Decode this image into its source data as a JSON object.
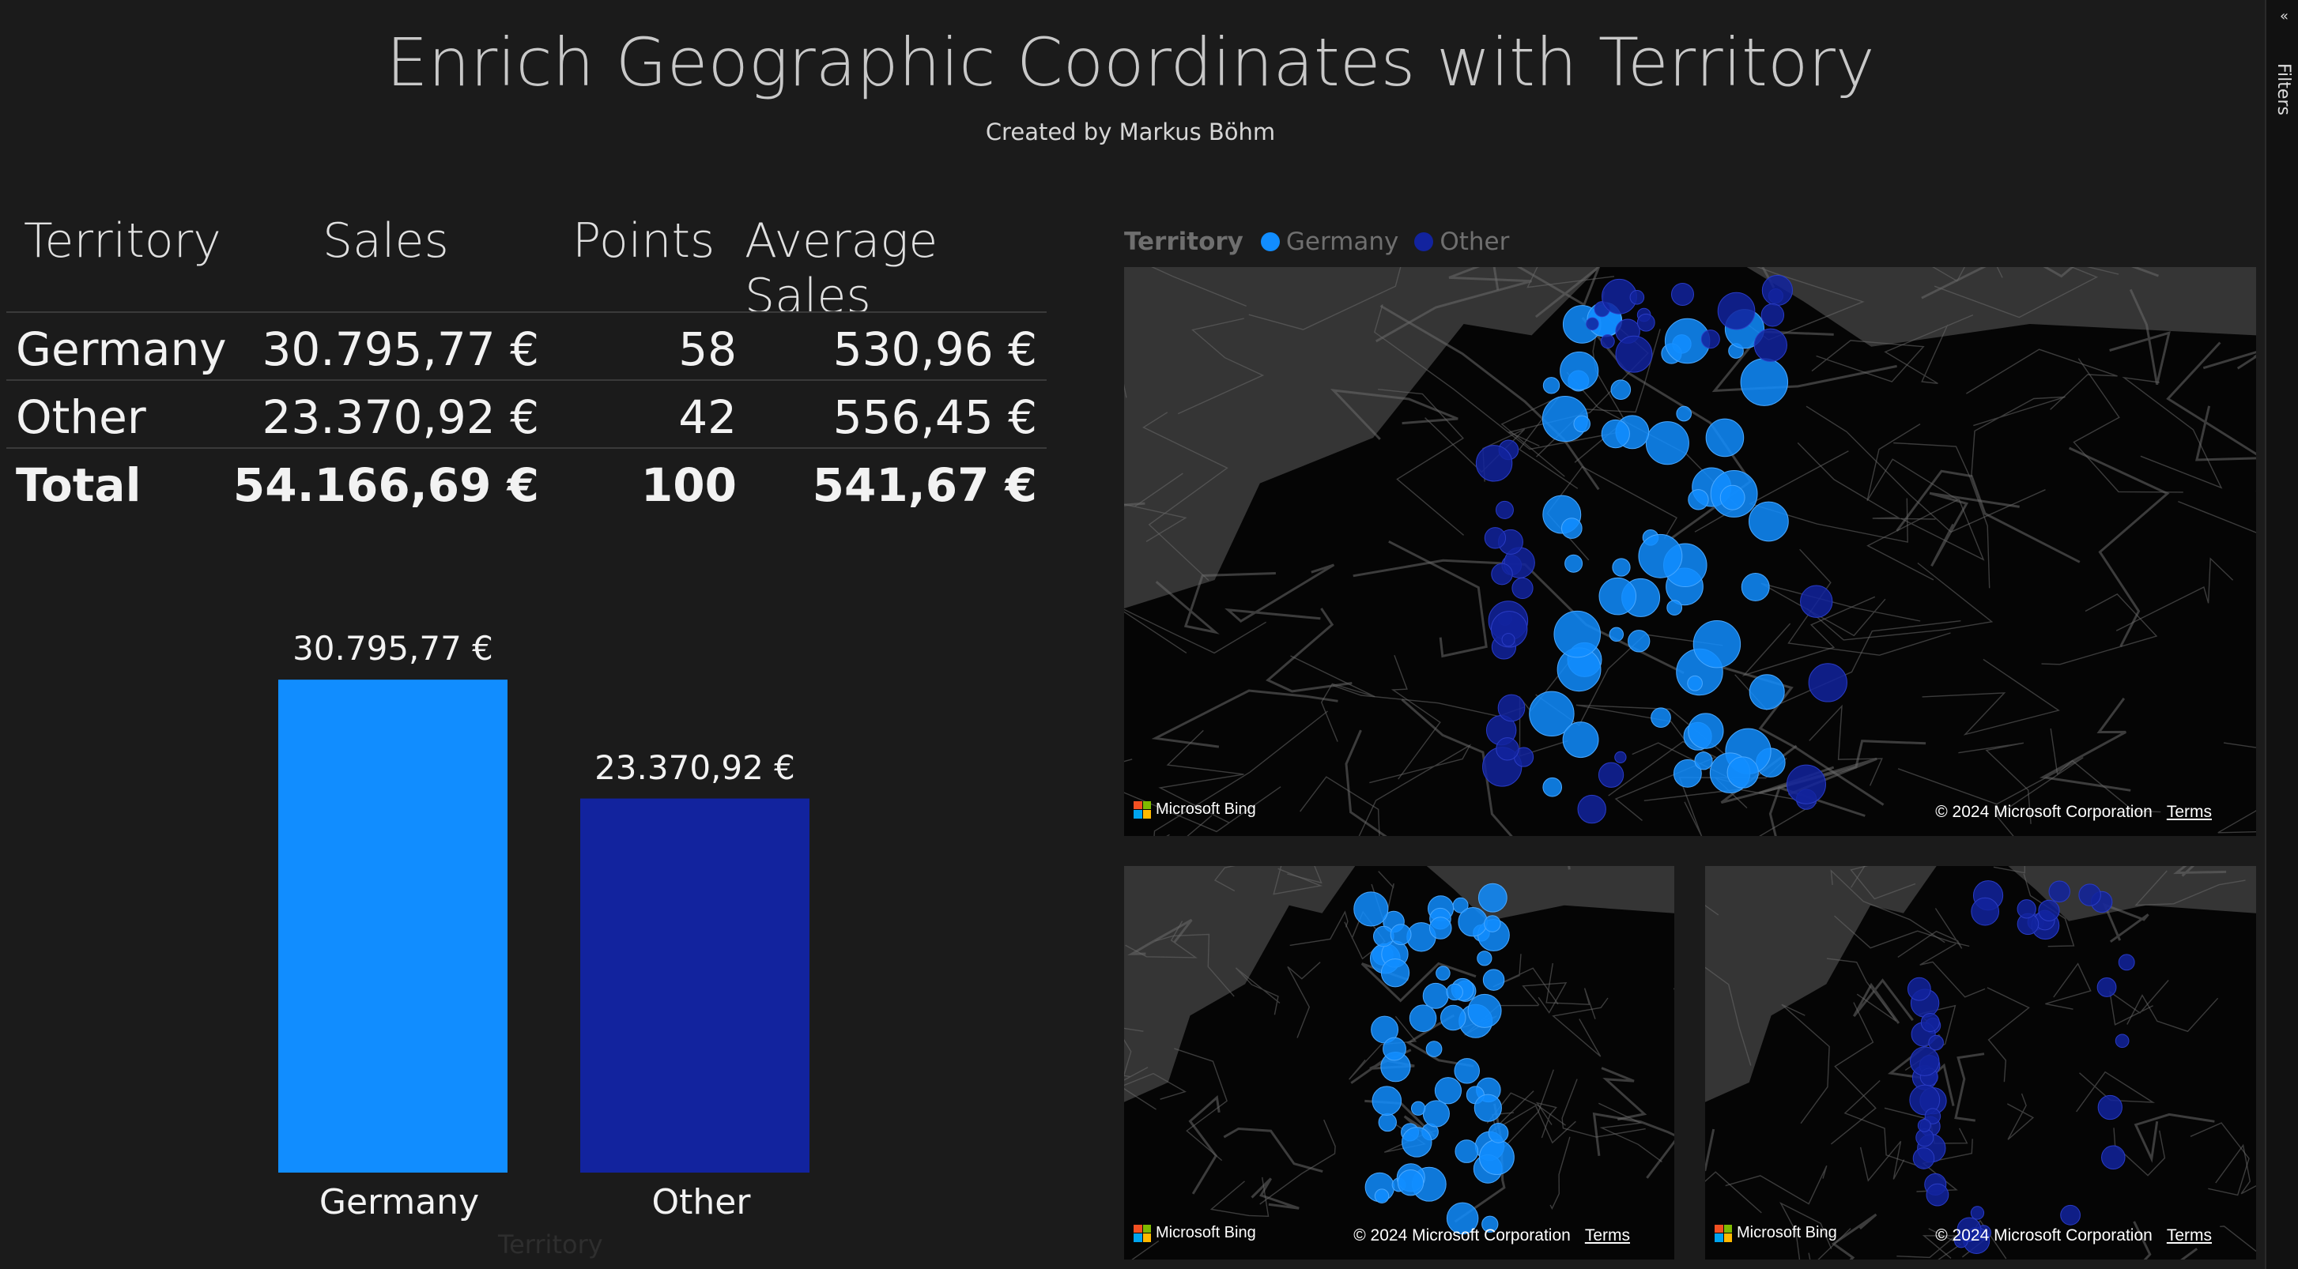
{
  "header": {
    "title": "Enrich Geographic Coordinates with Territory",
    "subtitle": "Created by Markus Böhm"
  },
  "table": {
    "headers": [
      "Territory",
      "Sales",
      "Points",
      "Average Sales"
    ],
    "rows": [
      {
        "territory": "Germany",
        "sales": "30.795,77 €",
        "points": "58",
        "avg": "530,96 €"
      },
      {
        "territory": "Other",
        "sales": "23.370,92 €",
        "points": "42",
        "avg": "556,45 €"
      }
    ],
    "total": {
      "territory": "Total",
      "sales": "54.166,69 €",
      "points": "100",
      "avg": "541,67 €"
    }
  },
  "chart_data": {
    "type": "bar",
    "categories": [
      "Germany",
      "Other"
    ],
    "values": [
      30795.77,
      23370.92
    ],
    "data_labels": [
      "30.795,77 €",
      "23.370,92 €"
    ],
    "colors": [
      "#118dff",
      "#12239e"
    ],
    "xlabel": "Territory",
    "ylabel": "",
    "ylim": [
      0,
      31000
    ]
  },
  "legend": {
    "title": "Territory",
    "items": [
      {
        "label": "Germany",
        "color": "#118dff"
      },
      {
        "label": "Other",
        "color": "#12239e"
      }
    ]
  },
  "maps": {
    "bing_label": "Microsoft Bing",
    "copyright": "© 2024 Microsoft Corporation",
    "terms": "Terms"
  },
  "filters": {
    "label": "Filters"
  }
}
